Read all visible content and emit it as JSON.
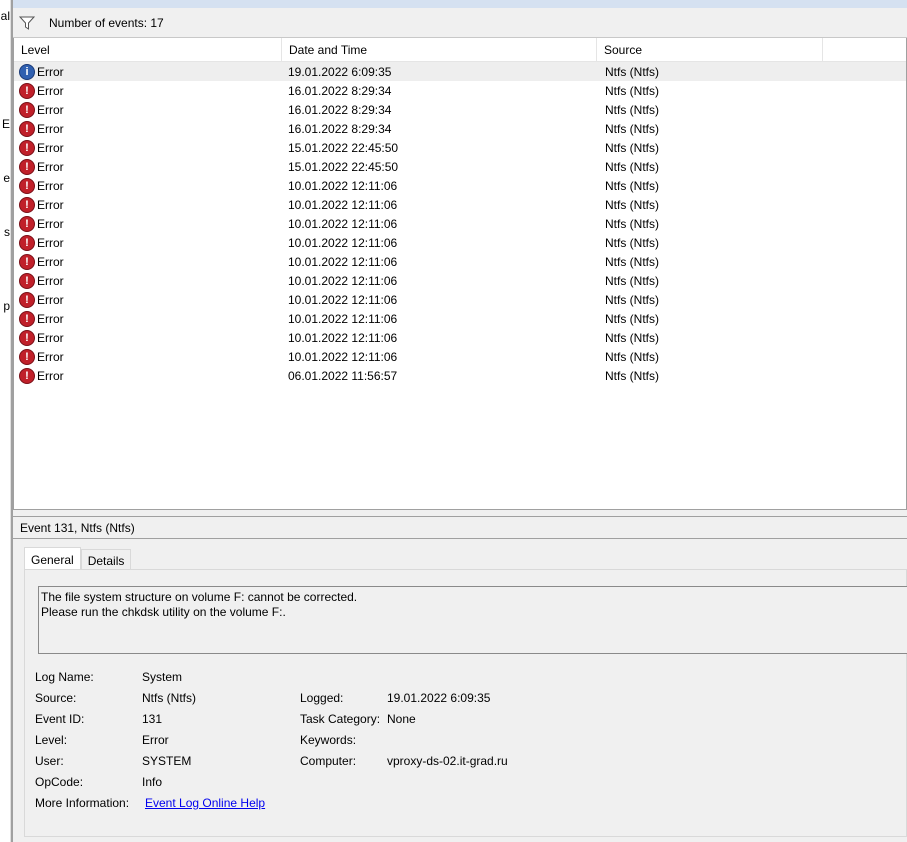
{
  "left_strip": [
    "al",
    "E",
    "e",
    "s",
    "p"
  ],
  "toolbar": {
    "count_label": "Number of events: 17",
    "filter_icon": "filter-icon"
  },
  "columns": [
    "Level",
    "Date and Time",
    "Source"
  ],
  "events": [
    {
      "level": "Error",
      "icon": "info",
      "datetime": "19.01.2022 6:09:35",
      "source": "Ntfs (Ntfs)"
    },
    {
      "level": "Error",
      "icon": "error",
      "datetime": "16.01.2022 8:29:34",
      "source": "Ntfs (Ntfs)"
    },
    {
      "level": "Error",
      "icon": "error",
      "datetime": "16.01.2022 8:29:34",
      "source": "Ntfs (Ntfs)"
    },
    {
      "level": "Error",
      "icon": "error",
      "datetime": "16.01.2022 8:29:34",
      "source": "Ntfs (Ntfs)"
    },
    {
      "level": "Error",
      "icon": "error",
      "datetime": "15.01.2022 22:45:50",
      "source": "Ntfs (Ntfs)"
    },
    {
      "level": "Error",
      "icon": "error",
      "datetime": "15.01.2022 22:45:50",
      "source": "Ntfs (Ntfs)"
    },
    {
      "level": "Error",
      "icon": "error",
      "datetime": "10.01.2022 12:11:06",
      "source": "Ntfs (Ntfs)"
    },
    {
      "level": "Error",
      "icon": "error",
      "datetime": "10.01.2022 12:11:06",
      "source": "Ntfs (Ntfs)"
    },
    {
      "level": "Error",
      "icon": "error",
      "datetime": "10.01.2022 12:11:06",
      "source": "Ntfs (Ntfs)"
    },
    {
      "level": "Error",
      "icon": "error",
      "datetime": "10.01.2022 12:11:06",
      "source": "Ntfs (Ntfs)"
    },
    {
      "level": "Error",
      "icon": "error",
      "datetime": "10.01.2022 12:11:06",
      "source": "Ntfs (Ntfs)"
    },
    {
      "level": "Error",
      "icon": "error",
      "datetime": "10.01.2022 12:11:06",
      "source": "Ntfs (Ntfs)"
    },
    {
      "level": "Error",
      "icon": "error",
      "datetime": "10.01.2022 12:11:06",
      "source": "Ntfs (Ntfs)"
    },
    {
      "level": "Error",
      "icon": "error",
      "datetime": "10.01.2022 12:11:06",
      "source": "Ntfs (Ntfs)"
    },
    {
      "level": "Error",
      "icon": "error",
      "datetime": "10.01.2022 12:11:06",
      "source": "Ntfs (Ntfs)"
    },
    {
      "level": "Error",
      "icon": "error",
      "datetime": "10.01.2022 12:11:06",
      "source": "Ntfs (Ntfs)"
    },
    {
      "level": "Error",
      "icon": "error",
      "datetime": "06.01.2022 11:56:57",
      "source": "Ntfs (Ntfs)"
    }
  ],
  "detail": {
    "title": "Event 131, Ntfs (Ntfs)",
    "tabs": [
      "General",
      "Details"
    ],
    "message_lines": [
      "The file system structure on volume F: cannot be corrected.",
      "Please run the chkdsk utility on the volume F:."
    ],
    "fields": {
      "log_name_label": "Log Name:",
      "log_name": "System",
      "source_label": "Source:",
      "source": "Ntfs (Ntfs)",
      "event_id_label": "Event ID:",
      "event_id": "131",
      "level_label": "Level:",
      "level": "Error",
      "user_label": "User:",
      "user": "SYSTEM",
      "opcode_label": "OpCode:",
      "opcode": "Info",
      "more_info_label": "More Information:",
      "more_info_link": "Event Log Online Help",
      "logged_label": "Logged:",
      "logged": "19.01.2022 6:09:35",
      "task_category_label": "Task Category:",
      "task_category": "None",
      "keywords_label": "Keywords:",
      "keywords": "",
      "computer_label": "Computer:",
      "computer": "vproxy-ds-02.it-grad.ru"
    }
  },
  "colors": {
    "error": "#c0202a",
    "info": "#3060b0",
    "link": "#0000ee"
  }
}
